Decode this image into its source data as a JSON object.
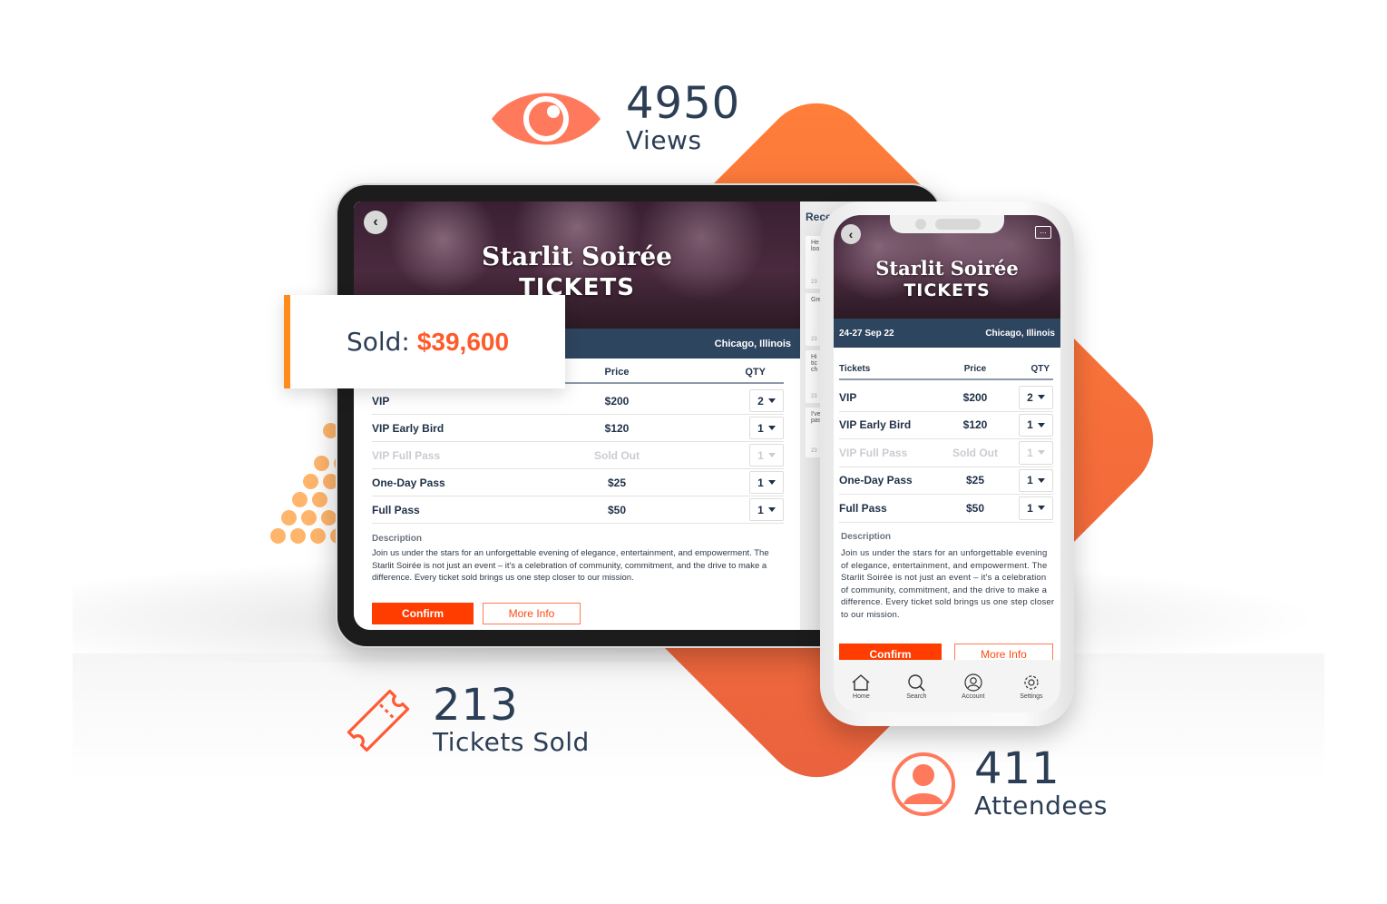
{
  "stats": {
    "views": {
      "value": "4950",
      "label": "Views",
      "icon": "eye-icon"
    },
    "tickets_sold": {
      "value": "213",
      "label": "Tickets Sold",
      "icon": "ticket-icon"
    },
    "attendees": {
      "value": "411",
      "label": "Attendees",
      "icon": "user-icon"
    }
  },
  "sold_card": {
    "label": "Sold:",
    "value": "$39,600"
  },
  "event": {
    "title": "Starlit Soirée",
    "subtitle": "TICKETS",
    "dates": "24-27 Sep 22",
    "location": "Chicago, Illinois"
  },
  "table": {
    "headers": {
      "tickets": "Tickets",
      "price": "Price",
      "qty": "QTY"
    },
    "rows": [
      {
        "name": "VIP",
        "price": "$200",
        "qty": "2",
        "disabled": false
      },
      {
        "name": "VIP Early Bird",
        "price": "$120",
        "qty": "1",
        "disabled": false
      },
      {
        "name": "VIP Full Pass",
        "price": "Sold Out",
        "qty": "1",
        "disabled": true
      },
      {
        "name": "One-Day Pass",
        "price": "$25",
        "qty": "1",
        "disabled": false
      },
      {
        "name": "Full Pass",
        "price": "$50",
        "qty": "1",
        "disabled": false
      }
    ]
  },
  "description": {
    "heading": "Description",
    "text": "Join us under the stars for an unforgettable evening of elegance, entertainment, and empowerment. The Starlit Soirée is not just an event – it's a celebration of community, commitment, and the drive to make a difference. Every ticket sold brings us one step closer to our mission."
  },
  "buttons": {
    "confirm": "Confirm",
    "more_info": "More Info"
  },
  "tablet_sidebar": {
    "title": "Recent",
    "messages": [
      {
        "snippet": "He\nloo",
        "time": "23"
      },
      {
        "snippet": "Gre",
        "time": "23"
      },
      {
        "snippet": "Hi\ntic\nch",
        "time": "23"
      },
      {
        "snippet": "I've\npas",
        "time": "23"
      }
    ]
  },
  "phone_nav": [
    {
      "label": "Home",
      "icon": "home-icon"
    },
    {
      "label": "Search",
      "icon": "search-icon"
    },
    {
      "label": "Account",
      "icon": "account-icon"
    },
    {
      "label": "Settings",
      "icon": "settings-icon"
    }
  ],
  "colors": {
    "accent": "#ff3d00",
    "brand_orange": "#f46c3a",
    "navy": "#2e4560",
    "icon_coral": "#ff7a5c",
    "dots": "#ffb56b"
  }
}
